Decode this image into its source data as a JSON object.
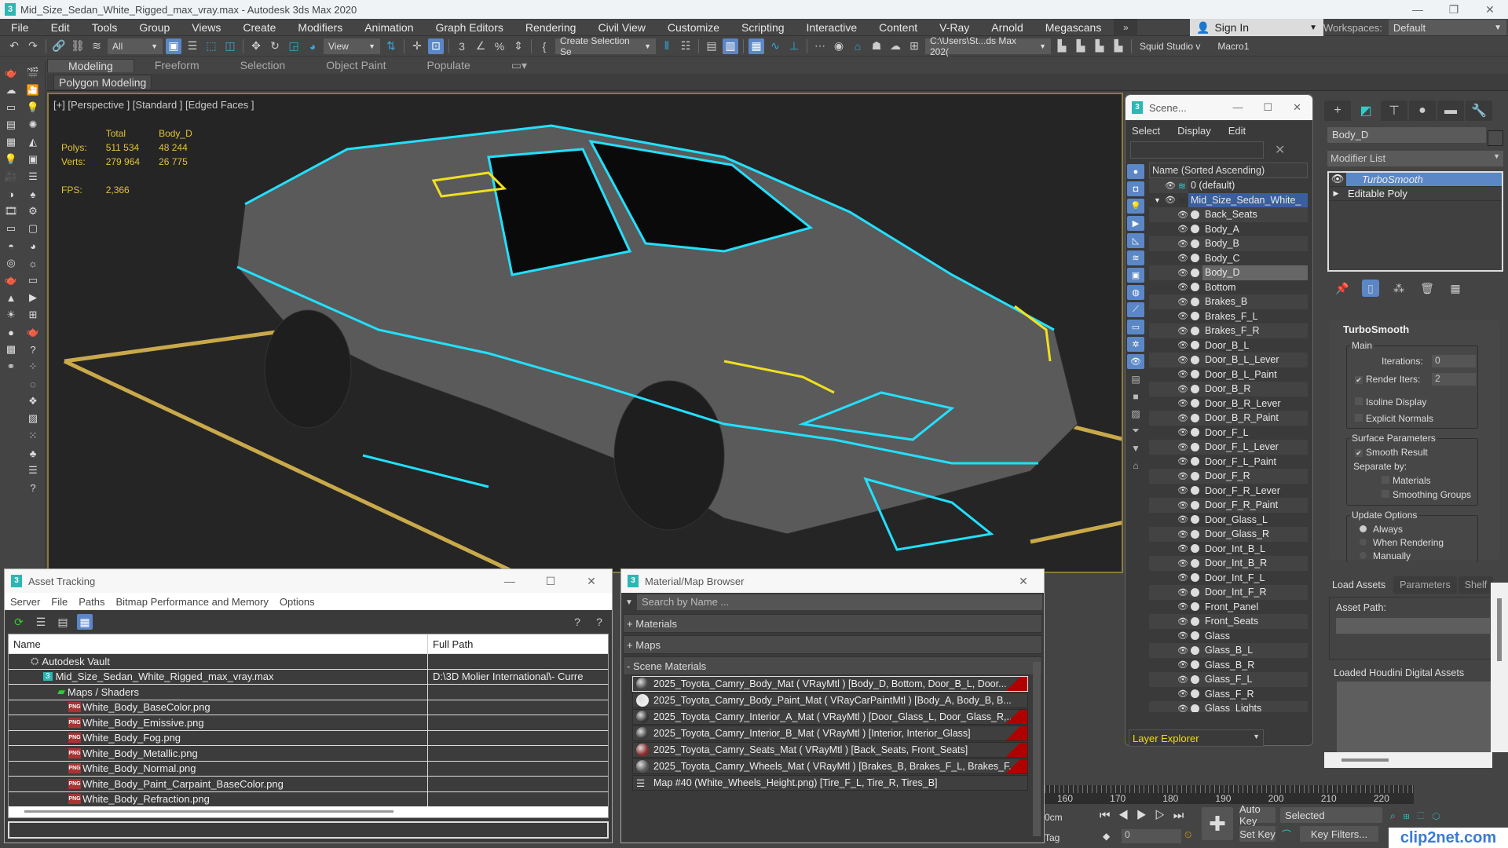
{
  "window": {
    "title": "Mid_Size_Sedan_White_Rigged_max_vray.max - Autodesk 3ds Max 2020",
    "app_icon": "3",
    "minimize": "—",
    "restore": "❐",
    "close": "✕"
  },
  "menu": [
    "File",
    "Edit",
    "Tools",
    "Group",
    "Views",
    "Create",
    "Modifiers",
    "Animation",
    "Graph Editors",
    "Rendering",
    "Civil View",
    "Customize",
    "Scripting",
    "Interactive",
    "Content",
    "V-Ray",
    "Arnold",
    "Megascans"
  ],
  "menu_more": "»",
  "signin": {
    "label": "Sign In"
  },
  "workspaces": {
    "label": "Workspaces:",
    "value": "Default"
  },
  "toolbar": {
    "selection_filter": "All",
    "ref_coord": "View",
    "named_selection": "Create Selection Se",
    "project_path": "C:\\Users\\St...ds Max 202(",
    "squid": "Squid Studio v",
    "macro": "Macro1"
  },
  "ribbon": {
    "tabs": [
      "Modeling",
      "Freeform",
      "Selection",
      "Object Paint",
      "Populate"
    ],
    "active": "Modeling",
    "subpanel": "Polygon Modeling"
  },
  "viewport": {
    "label": "[+] [Perspective ] [Standard ] [Edged Faces ]",
    "stats": {
      "col_total": "Total",
      "col_obj": "Body_D",
      "polys_label": "Polys:",
      "polys_total": "511 534",
      "polys_obj": "48 244",
      "verts_label": "Verts:",
      "verts_total": "279 964",
      "verts_obj": "26 775",
      "fps_label": "FPS:",
      "fps": "2,366"
    }
  },
  "scene_explorer": {
    "title": "Scene...",
    "menu": [
      "Select",
      "Display",
      "Edit"
    ],
    "column": "Name (Sorted Ascending)",
    "layers": [
      {
        "name": "0 (default)"
      },
      {
        "name": "Mid_Size_Sedan_White_"
      }
    ],
    "objects": [
      "Back_Seats",
      "Body_A",
      "Body_B",
      "Body_C",
      "Body_D",
      "Bottom",
      "Brakes_B",
      "Brakes_F_L",
      "Brakes_F_R",
      "Door_B_L",
      "Door_B_L_Lever",
      "Door_B_L_Paint",
      "Door_B_R",
      "Door_B_R_Lever",
      "Door_B_R_Paint",
      "Door_F_L",
      "Door_F_L_Lever",
      "Door_F_L_Paint",
      "Door_F_R",
      "Door_F_R_Lever",
      "Door_F_R_Paint",
      "Door_Glass_L",
      "Door_Glass_R",
      "Door_Int_B_L",
      "Door_Int_B_R",
      "Door_Int_F_L",
      "Door_Int_F_R",
      "Front_Panel",
      "Front_Seats",
      "Glass",
      "Glass_B_L",
      "Glass_B_R",
      "Glass_F_L",
      "Glass_F_R",
      "Glass_Lights"
    ],
    "highlighted": "Body_D",
    "footer": "Layer Explorer"
  },
  "command_panel": {
    "object_name": "Body_D",
    "modifier_list": "Modifier List",
    "stack": [
      "TurboSmooth",
      "Editable Poly"
    ],
    "turbosmooth": {
      "title": "TurboSmooth",
      "main": "Main",
      "iterations_label": "Iterations:",
      "iterations": "0",
      "render_iters_label": "Render Iters:",
      "render_iters": "2",
      "render_iters_checked": true,
      "isoline": "Isoline Display",
      "explicit_normals": "Explicit Normals",
      "surface": "Surface Parameters",
      "smooth_result": "Smooth Result",
      "separate_by": "Separate by:",
      "materials": "Materials",
      "smoothing_groups": "Smoothing Groups",
      "update": "Update Options",
      "always": "Always",
      "when_rendering": "When Rendering",
      "manually": "Manually",
      "update_selected": "Always"
    }
  },
  "houdini": {
    "tabs": [
      "Load Assets",
      "Parameters",
      "Shelf"
    ],
    "asset_path": "Asset Path:",
    "loaded": "Loaded Houdini Digital Assets"
  },
  "asset_tracking": {
    "title": "Asset Tracking",
    "menu": [
      "Server",
      "File",
      "Paths",
      "Bitmap Performance and Memory",
      "Options"
    ],
    "columns": [
      "Name",
      "Full Path"
    ],
    "rows": [
      {
        "name": "Autodesk Vault",
        "path": "",
        "indent": 0,
        "icon": "vault"
      },
      {
        "name": "Mid_Size_Sedan_White_Rigged_max_vray.max",
        "path": "D:\\3D Molier International\\- Curre",
        "indent": 1,
        "icon": "max"
      },
      {
        "name": "Maps / Shaders",
        "path": "",
        "indent": 2,
        "icon": "maps"
      },
      {
        "name": "White_Body_BaseColor.png",
        "path": "",
        "indent": 3,
        "icon": "png"
      },
      {
        "name": "White_Body_Emissive.png",
        "path": "",
        "indent": 3,
        "icon": "png"
      },
      {
        "name": "White_Body_Fog.png",
        "path": "",
        "indent": 3,
        "icon": "png"
      },
      {
        "name": "White_Body_Metallic.png",
        "path": "",
        "indent": 3,
        "icon": "png"
      },
      {
        "name": "White_Body_Normal.png",
        "path": "",
        "indent": 3,
        "icon": "png"
      },
      {
        "name": "White_Body_Paint_Carpaint_BaseColor.png",
        "path": "",
        "indent": 3,
        "icon": "png"
      },
      {
        "name": "White_Body_Refraction.png",
        "path": "",
        "indent": 3,
        "icon": "png"
      }
    ]
  },
  "material_browser": {
    "title": "Material/Map Browser",
    "search_placeholder": "Search by Name ...",
    "sections": [
      "+ Materials",
      "+ Maps",
      "- Scene Materials"
    ],
    "items": [
      {
        "label": "2025_Toyota_Camry_Body_Mat ( VRayMtl ) [Body_D, Bottom, Door_B_L, Door...",
        "swatch": "#444",
        "flag": true
      },
      {
        "label": "2025_Toyota_Camry_Body_Paint_Mat ( VRayCarPaintMtl ) [Body_A, Body_B, B...",
        "swatch": "#eee",
        "flag": false
      },
      {
        "label": "2025_Toyota_Camry_Interior_A_Mat ( VRayMtl ) [Door_Glass_L, Door_Glass_R,...",
        "swatch": "#333",
        "flag": true
      },
      {
        "label": "2025_Toyota_Camry_Interior_B_Mat ( VRayMtl ) [Interior, Interior_Glass]",
        "swatch": "#3a3a3a",
        "flag": true
      },
      {
        "label": "2025_Toyota_Camry_Seats_Mat ( VRayMtl ) [Back_Seats, Front_Seats]",
        "swatch": "#8a2a2a",
        "flag": true
      },
      {
        "label": "2025_Toyota_Camry_Wheels_Mat ( VRayMtl ) [Brakes_B, Brakes_F_L, Brakes_F...",
        "swatch": "#555",
        "flag": true
      },
      {
        "label": "Map #40 (White_Wheels_Height.png) [Tire_F_L, Tire_R, Tires_B]",
        "swatch": "map",
        "flag": false
      }
    ]
  },
  "timeline": {
    "ticks": [
      "160",
      "170",
      "180",
      "190",
      "200",
      "210",
      "220"
    ]
  },
  "anim": {
    "unit": "0cm",
    "tag": "Tag",
    "frame": "0",
    "auto_key": "Auto Key",
    "set_key": "Set Key",
    "selected": "Selected",
    "key_filters": "Key Filters..."
  },
  "watermark": "clip2net.com",
  "colors": {
    "accent": "#5b87c6",
    "stats": "#e0c23a",
    "wire": "#22e0ff",
    "layer_explorer": "#f0e000"
  }
}
